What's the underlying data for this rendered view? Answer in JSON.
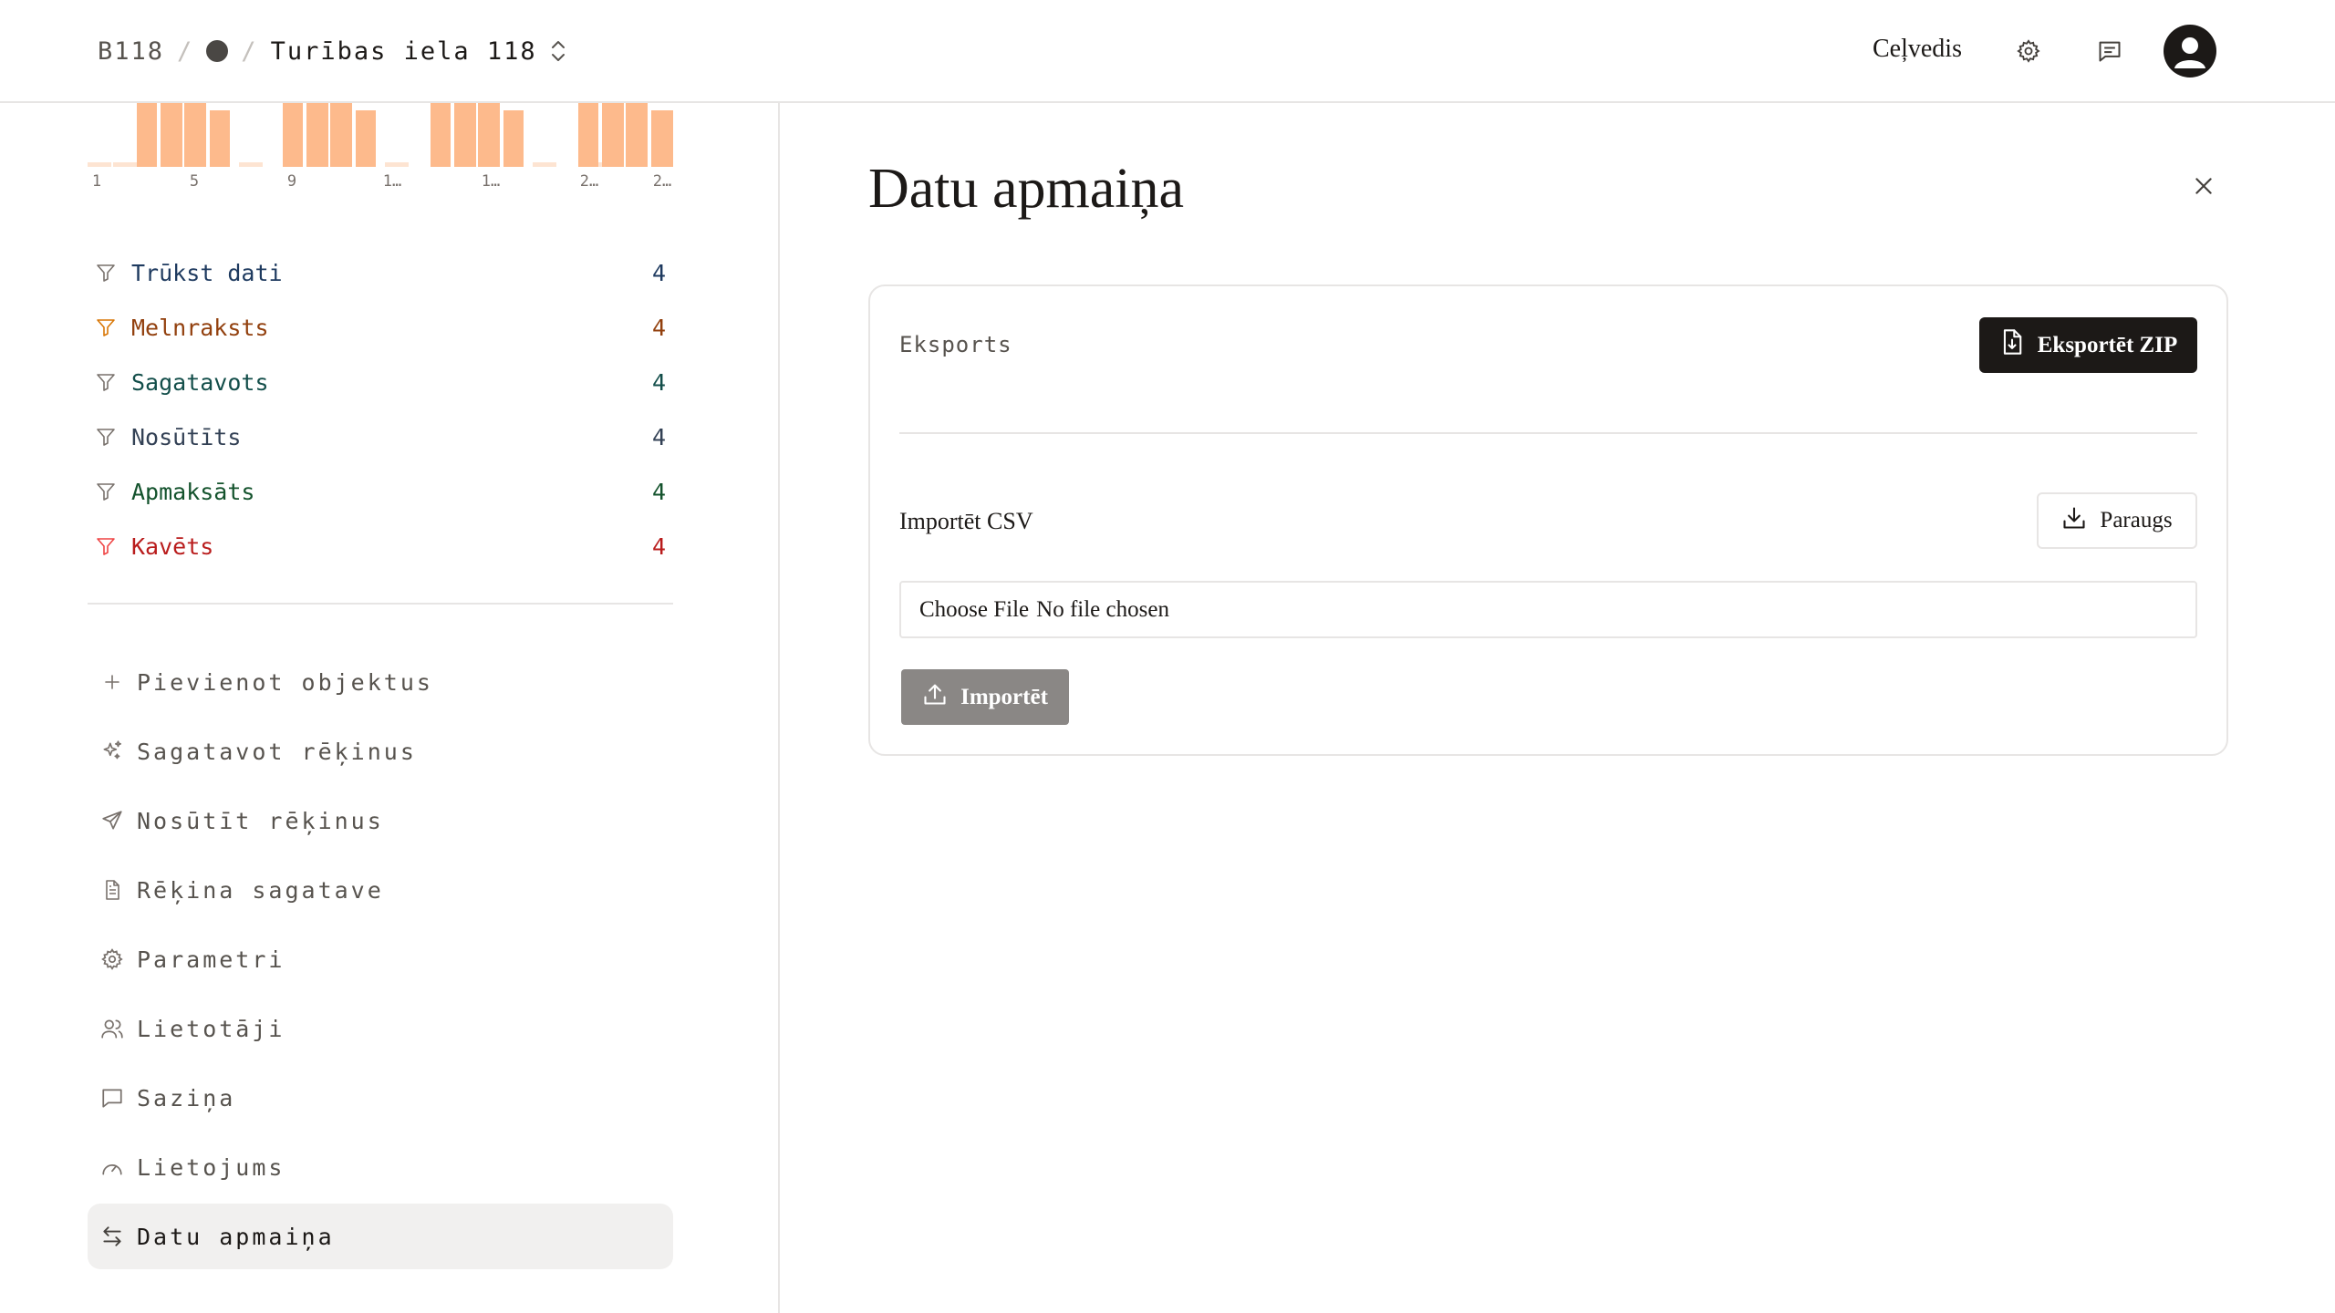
{
  "header": {
    "code": "B118",
    "separator": "/",
    "address": "Turības iela 118",
    "guide_label": "Ceļvedis",
    "icons": {
      "settings": "gear-icon",
      "messages": "message-square-icon",
      "avatar": "user-avatar-icon",
      "switcher": "chevron-up-down-icon"
    }
  },
  "sidebar": {
    "chart_ticks": [
      "1",
      "5",
      "9",
      "1…",
      "1…",
      "2…",
      "2…"
    ],
    "filters": [
      {
        "label": "Trūkst dati",
        "count": "4",
        "color": "#1e3a5f",
        "icon_color": "#78716c"
      },
      {
        "label": "Melnraksts",
        "count": "4",
        "color": "#92400e",
        "icon_color": "#d97706"
      },
      {
        "label": "Sagatavots",
        "count": "4",
        "color": "#134e4a",
        "icon_color": "#78716c"
      },
      {
        "label": "Nosūtīts",
        "count": "4",
        "color": "#334155",
        "icon_color": "#78716c"
      },
      {
        "label": "Apmaksāts",
        "count": "4",
        "color": "#14532d",
        "icon_color": "#78716c"
      },
      {
        "label": "Kavēts",
        "count": "4",
        "color": "#b91c1c",
        "icon_color": "#ef4444"
      }
    ],
    "nav": [
      {
        "label": "Pievienot objektus",
        "icon": "plus-icon"
      },
      {
        "label": "Sagatavot rēķinus",
        "icon": "sparkles-icon"
      },
      {
        "label": "Nosūtīt rēķinus",
        "icon": "send-icon"
      },
      {
        "label": "Rēķina sagatave",
        "icon": "file-text-icon"
      },
      {
        "label": "Parametri",
        "icon": "gear-icon"
      },
      {
        "label": "Lietotāji",
        "icon": "users-icon"
      },
      {
        "label": "Saziņa",
        "icon": "message-square-icon"
      },
      {
        "label": "Lietojums",
        "icon": "gauge-icon"
      },
      {
        "label": "Datu apmaiņa",
        "icon": "arrows-exchange-icon",
        "active": true
      }
    ]
  },
  "main": {
    "title": "Datu apmaiņa",
    "export": {
      "label": "Eksports",
      "button": "Eksportēt ZIP"
    },
    "import": {
      "label": "Importēt CSV",
      "sample_button": "Paraugs",
      "file_button": "Choose File",
      "file_status": "No file chosen",
      "submit": "Importēt"
    }
  },
  "colors": {
    "accent_dark": "#1c1917",
    "bar": "#fdba8c",
    "bar_base": "#fde4d2",
    "disabled": "#8a8785"
  }
}
